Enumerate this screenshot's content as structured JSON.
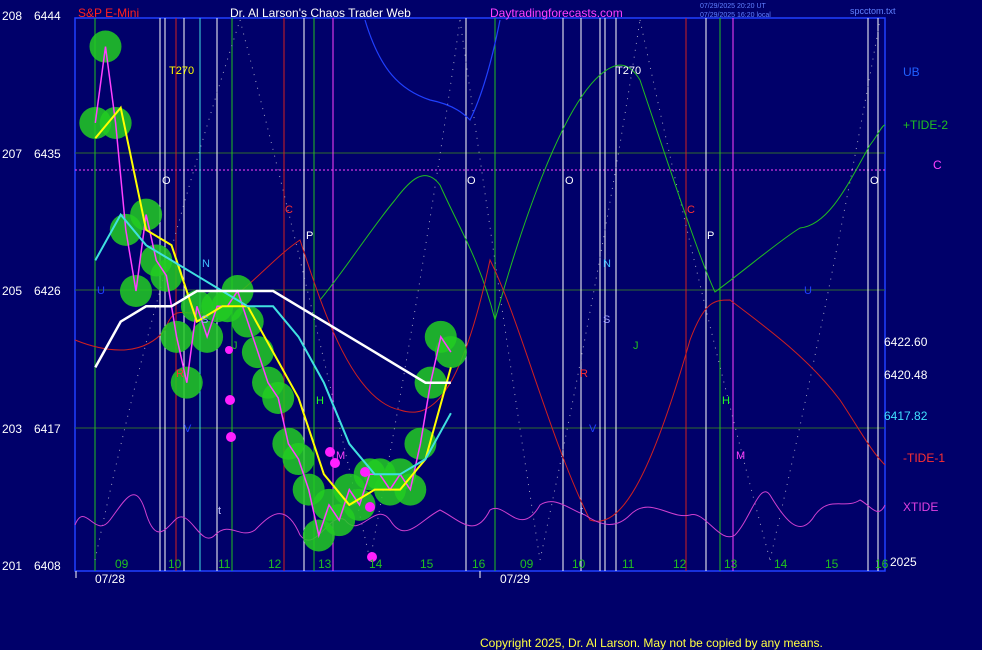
{
  "header": {
    "symbol": "S&P E-Mini",
    "title": "Dr. Al Larson's Chaos Trader Web",
    "site": "Daytradingforecasts.com",
    "ut_line": "07/29/2025 20:20 UT",
    "local_line": "07/29/2025 16:20 local",
    "file": "spcctom.txt"
  },
  "footer": {
    "copyright": "Copyright 2025, Dr. Al Larson. May not be copied by any means.",
    "year": "2025"
  },
  "colors": {
    "background": "#00006a",
    "grid": "#2f6b2f",
    "price": "#ff40ff",
    "cloud": "#22cc22",
    "fast_ma": "#ffff00",
    "mid_ma": "#40e0e0",
    "slow_ma": "#ffffff",
    "tide_plus": "#20c020",
    "tide_minus": "#d02020",
    "xtide": "#d040d0",
    "ub": "#2040ff",
    "level_line": "#ff40ff"
  },
  "chart_data": {
    "type": "line",
    "xlabel": "",
    "ylabel": "",
    "y_left_primary": {
      "ticks": [
        201,
        203,
        205,
        207,
        208
      ]
    },
    "y_left_price": {
      "ticks": [
        6408,
        6417,
        6426,
        6435,
        6444
      ],
      "ylim": [
        6408,
        6444
      ]
    },
    "x_hour_ticks": [
      "09",
      "10",
      "11",
      "12",
      "13",
      "14",
      "15",
      "16",
      "09",
      "10",
      "11",
      "12",
      "13",
      "14",
      "15",
      "16"
    ],
    "x_dates": [
      "07/28",
      "07/29"
    ],
    "right_levels": [
      "6422.60",
      "6420.48",
      "6417.82"
    ],
    "curve_labels": [
      "UB",
      "+TIDE-2",
      "C",
      "-TIDE-1",
      "XTIDE"
    ],
    "marker_labels": [
      "T270",
      "T270",
      "O",
      "O",
      "O",
      "O",
      "N",
      "N",
      "S",
      "S",
      "P",
      "P",
      "C",
      "C",
      "R",
      "R",
      "J",
      "J",
      "H",
      "H",
      "M",
      "M",
      "U",
      "U",
      "V",
      "V",
      "t",
      "t"
    ],
    "series": [
      {
        "name": "S&P E-Mini",
        "x": [
          9.0,
          9.2,
          9.4,
          9.6,
          9.8,
          10.0,
          10.2,
          10.4,
          10.6,
          10.8,
          11.0,
          11.2,
          11.4,
          11.6,
          11.8,
          12.0,
          12.2,
          12.4,
          12.6,
          12.8,
          13.0,
          13.2,
          13.4,
          13.6,
          13.8,
          14.0,
          14.2,
          14.4,
          14.6,
          14.8,
          15.0,
          15.2,
          15.4,
          15.6,
          15.8,
          16.0
        ],
        "y": [
          6437,
          6442,
          6437,
          6430,
          6426,
          6431,
          6428,
          6427,
          6423,
          6420,
          6425,
          6423,
          6425,
          6425,
          6426,
          6424,
          6422,
          6420,
          6419,
          6416,
          6415,
          6413,
          6410,
          6412,
          6411,
          6413,
          6412,
          6414,
          6414,
          6413,
          6414,
          6413,
          6416,
          6420,
          6423,
          6422
        ]
      },
      {
        "name": "",
        "x": [
          9.0,
          9.5,
          10.0,
          10.5,
          11.0,
          11.5,
          12.0,
          12.5,
          13.0,
          13.5,
          14.0,
          14.5,
          15.0,
          15.5,
          16.0
        ],
        "y": [
          6436,
          6438,
          6430,
          6429,
          6424,
          6425,
          6425,
          6422,
          6419,
          6414,
          6412,
          6413,
          6413,
          6415,
          6421
        ]
      },
      {
        "name": "",
        "x": [
          9.0,
          9.5,
          10.0,
          10.5,
          11.0,
          11.5,
          12.0,
          12.5,
          13.0,
          13.5,
          14.0,
          14.5,
          15.0,
          15.5,
          16.0
        ],
        "y": [
          6428,
          6431,
          6429,
          6428,
          6427,
          6426,
          6425,
          6425,
          6423,
          6420,
          6416,
          6414,
          6414,
          6415,
          6418
        ]
      },
      {
        "name": "",
        "x": [
          9.0,
          9.5,
          10.0,
          10.5,
          11.0,
          11.5,
          12.0,
          12.5,
          13.0,
          13.5,
          14.0,
          14.5,
          15.0,
          15.5,
          16.0
        ],
        "y": [
          6421,
          6424,
          6425,
          6425,
          6426,
          6426,
          6426,
          6426,
          6425,
          6424,
          6423,
          6422,
          6421,
          6420,
          6420
        ]
      }
    ]
  }
}
